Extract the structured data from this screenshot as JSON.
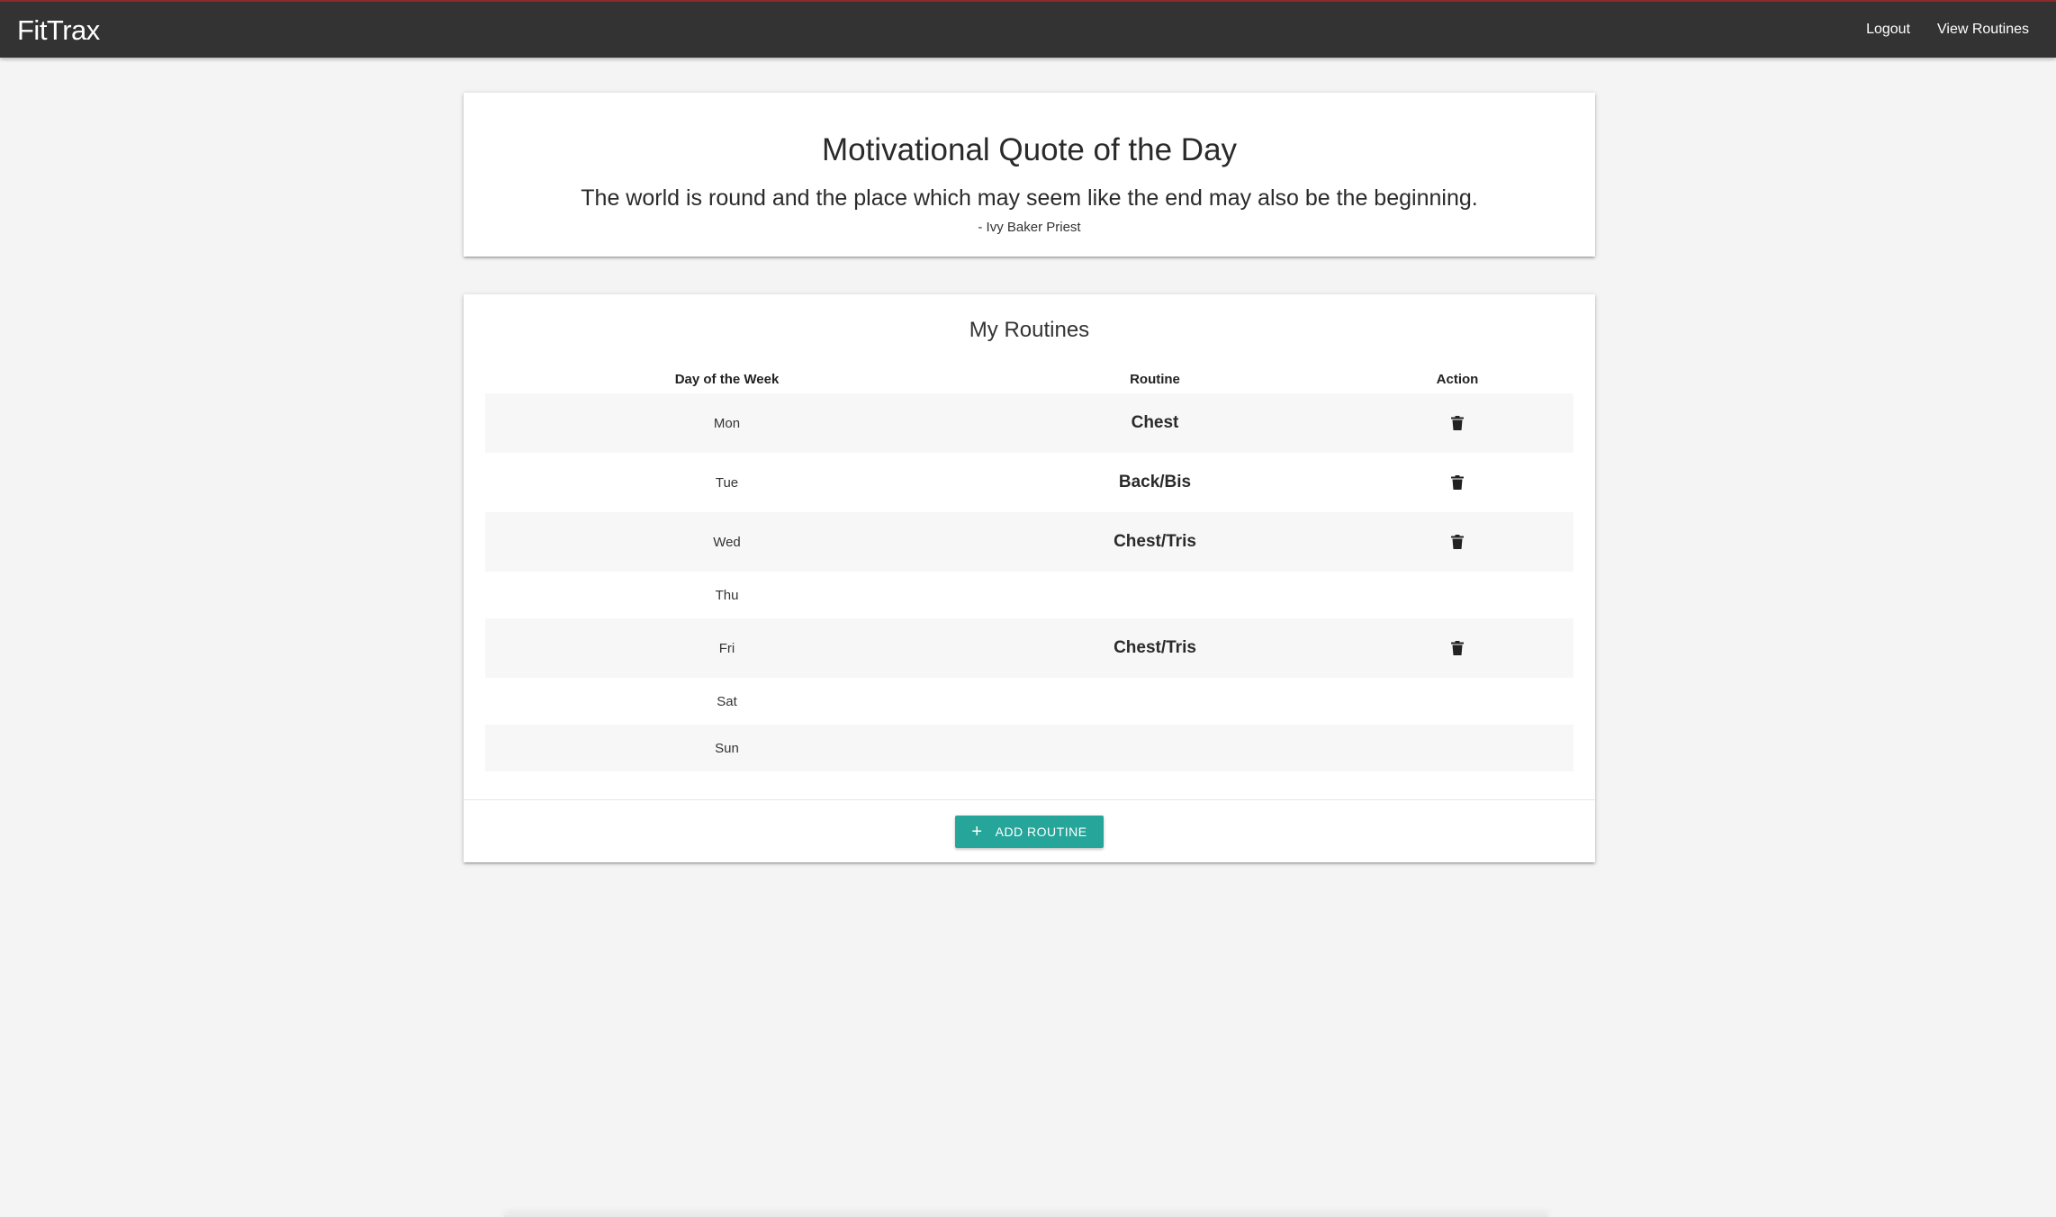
{
  "navbar": {
    "brand": "FitTrax",
    "links": [
      {
        "label": "Logout"
      },
      {
        "label": "View Routines"
      }
    ]
  },
  "quote": {
    "title": "Motivational Quote of the Day",
    "text": "The world is round and the place which may seem like the end may also be the beginning.",
    "author": "- Ivy Baker Priest"
  },
  "routines": {
    "title": "My Routines",
    "headers": {
      "day": "Day of the Week",
      "routine": "Routine",
      "action": "Action"
    },
    "rows": [
      {
        "day": "Mon",
        "routine": "Chest",
        "has_delete": true
      },
      {
        "day": "Tue",
        "routine": "Back/Bis",
        "has_delete": true
      },
      {
        "day": "Wed",
        "routine": "Chest/Tris",
        "has_delete": true
      },
      {
        "day": "Thu",
        "routine": "",
        "has_delete": false
      },
      {
        "day": "Fri",
        "routine": "Chest/Tris",
        "has_delete": true
      },
      {
        "day": "Sat",
        "routine": "",
        "has_delete": false
      },
      {
        "day": "Sun",
        "routine": "",
        "has_delete": false
      }
    ],
    "add_button": {
      "label": "Add Routine",
      "icon": "plus-icon"
    }
  },
  "colors": {
    "navbar_bg": "#333333",
    "accent": "#26a69a",
    "page_bg": "#f4f4f4"
  }
}
